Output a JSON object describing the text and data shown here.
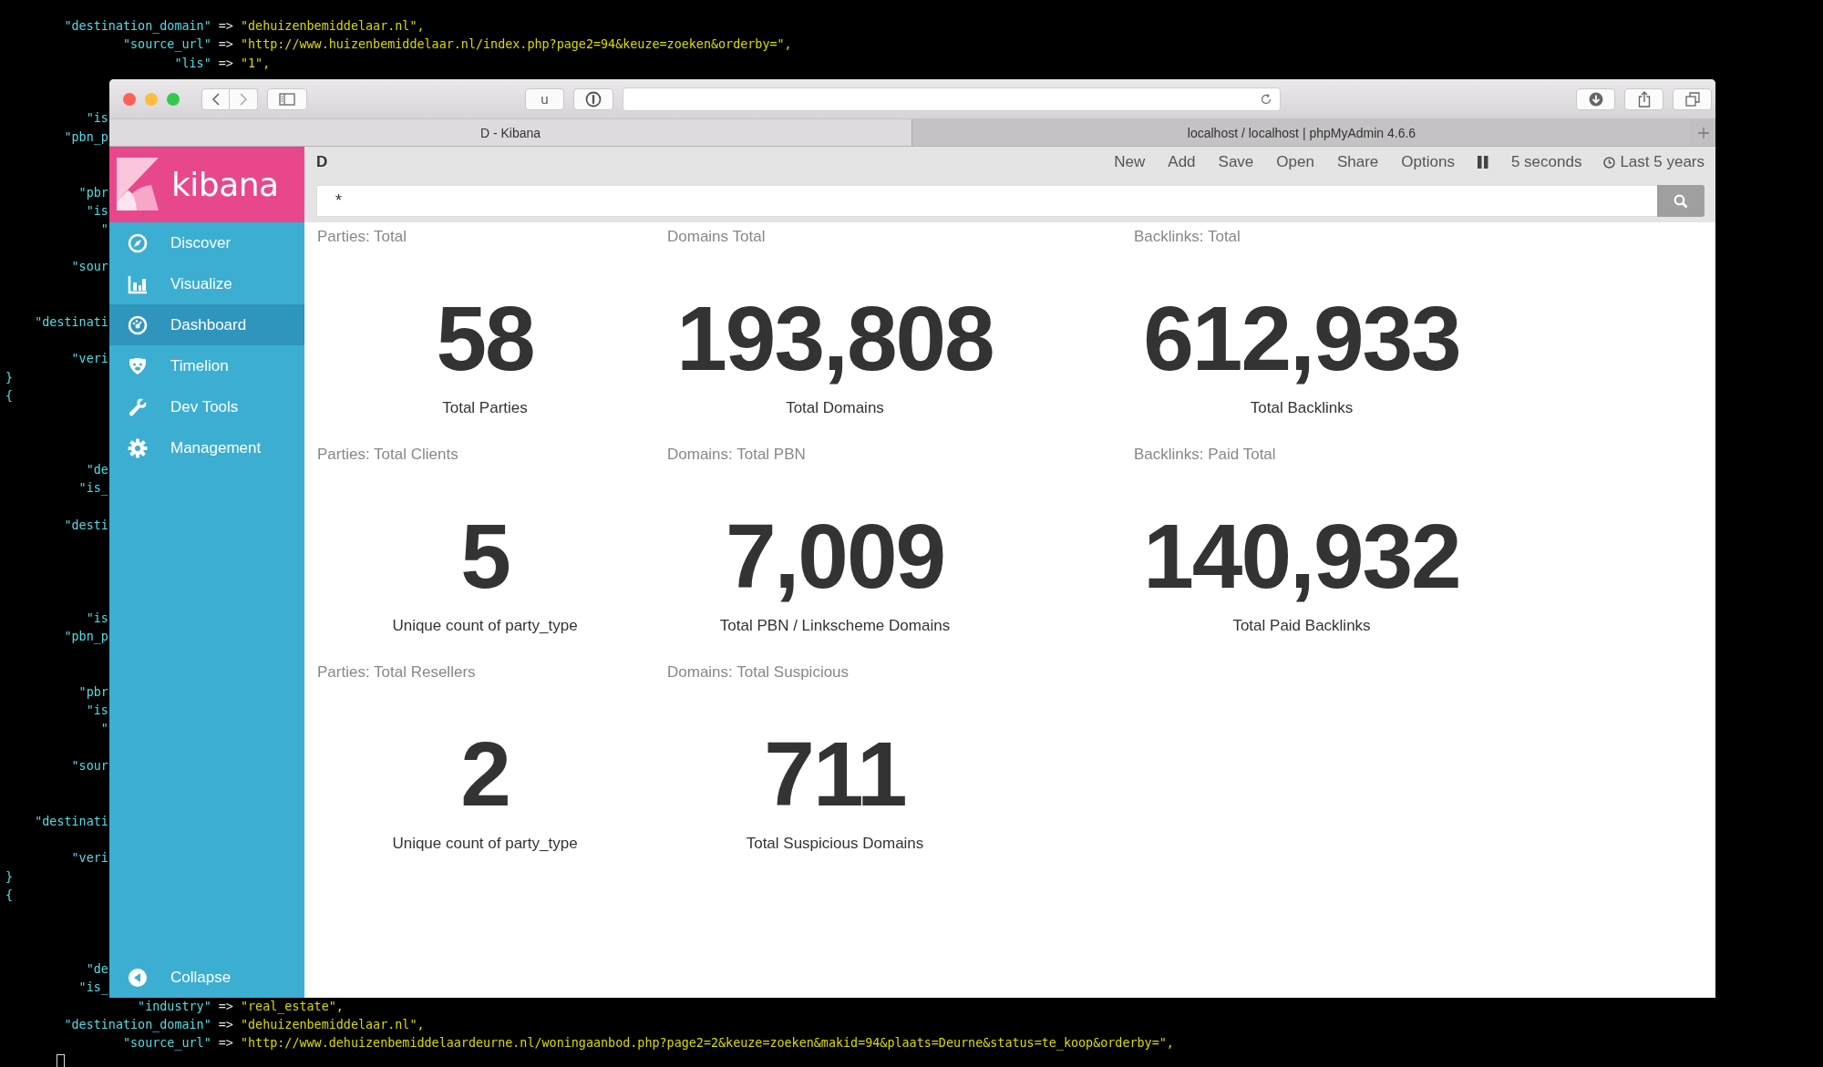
{
  "terminal": {
    "lines": [
      {
        "key": "        \"destination_domain\"",
        "sep": " => ",
        "value": "\"dehuizenbemiddelaar.nl\","
      },
      {
        "key": "                \"source_url\"",
        "sep": " => ",
        "value": "\"http://www.huizenbemiddelaar.nl/index.php?page2=94&keuze=zoeken&orderby=\","
      },
      {
        "key": "                       \"lis\"",
        "sep": " => ",
        "value": "\"1\","
      },
      {
        "key": "           \"is"
      },
      {
        "key": "        \"pbn_p"
      },
      {
        "key": "          \"pbr"
      },
      {
        "key": "           \"is"
      },
      {
        "key": "             \""
      },
      {
        "key": "         \"sour"
      },
      {
        "key": "    \"destinati"
      },
      {
        "key": "         \"veri"
      },
      {
        "key": "}"
      },
      {
        "key": "{"
      },
      {
        "key": "           \"de"
      },
      {
        "key": "          \"is_"
      },
      {
        "key": "        \"desti"
      },
      {
        "key": "           \"is"
      },
      {
        "key": "        \"pbn_p"
      },
      {
        "key": "          \"pbr"
      },
      {
        "key": "           \"is"
      },
      {
        "key": "             \""
      },
      {
        "key": "         \"sour"
      },
      {
        "key": "    \"destinati"
      },
      {
        "key": "         \"veri"
      },
      {
        "key": "}"
      },
      {
        "key": "{"
      },
      {
        "key": "           \"de"
      },
      {
        "key": "          \"is_"
      },
      {
        "key": "                  \"industry\"",
        "sep": " => ",
        "value": "\"real_estate\","
      },
      {
        "key": "        \"destination_domain\"",
        "sep": " => ",
        "value": "\"dehuizenbemiddelaar.nl\","
      },
      {
        "key": "                \"source_url\"",
        "sep": " => ",
        "value": "\"http://www.dehuizenbemiddelaardeurne.nl/woningaanbod.php?page2=2&keuze=zoeken&makid=94&plaats=Deurne&status=te_koop&orderby=\","
      }
    ]
  },
  "browser": {
    "extension_button": "u",
    "tabs": [
      {
        "label": "D - Kibana",
        "selected": true
      },
      {
        "label": "localhost / localhost | phpMyAdmin 4.6.6",
        "selected": false
      }
    ]
  },
  "kibana": {
    "logo": "kibana",
    "nav": [
      {
        "label": "Discover",
        "selected": false
      },
      {
        "label": "Visualize",
        "selected": false
      },
      {
        "label": "Dashboard",
        "selected": true
      },
      {
        "label": "Timelion",
        "selected": false
      },
      {
        "label": "Dev Tools",
        "selected": false
      },
      {
        "label": "Management",
        "selected": false
      }
    ],
    "collapse": "Collapse",
    "dashboard_title": "D",
    "menu": [
      "New",
      "Add",
      "Save",
      "Open",
      "Share",
      "Options"
    ],
    "refresh_interval": "5 seconds",
    "time_range": "Last 5 years",
    "query": "*",
    "panels": [
      [
        {
          "title": "Parties: Total",
          "value": "58",
          "label": "Total Parties"
        },
        {
          "title": "Domains Total",
          "value": "193,808",
          "label": "Total Domains"
        },
        {
          "title": "Backlinks: Total",
          "value": "612,933",
          "label": "Total Backlinks"
        }
      ],
      [
        {
          "title": "Parties: Total Clients",
          "value": "5",
          "label": "Unique count of party_type"
        },
        {
          "title": "Domains: Total PBN",
          "value": "7,009",
          "label": "Total PBN / Linkscheme Domains"
        },
        {
          "title": "Backlinks: Paid Total",
          "value": "140,932",
          "label": "Total Paid Backlinks"
        }
      ],
      [
        {
          "title": "Parties: Total Resellers",
          "value": "2",
          "label": "Unique count of party_type"
        },
        {
          "title": "Domains: Total Suspicious",
          "value": "711",
          "label": "Total Suspicious Domains"
        }
      ]
    ]
  }
}
